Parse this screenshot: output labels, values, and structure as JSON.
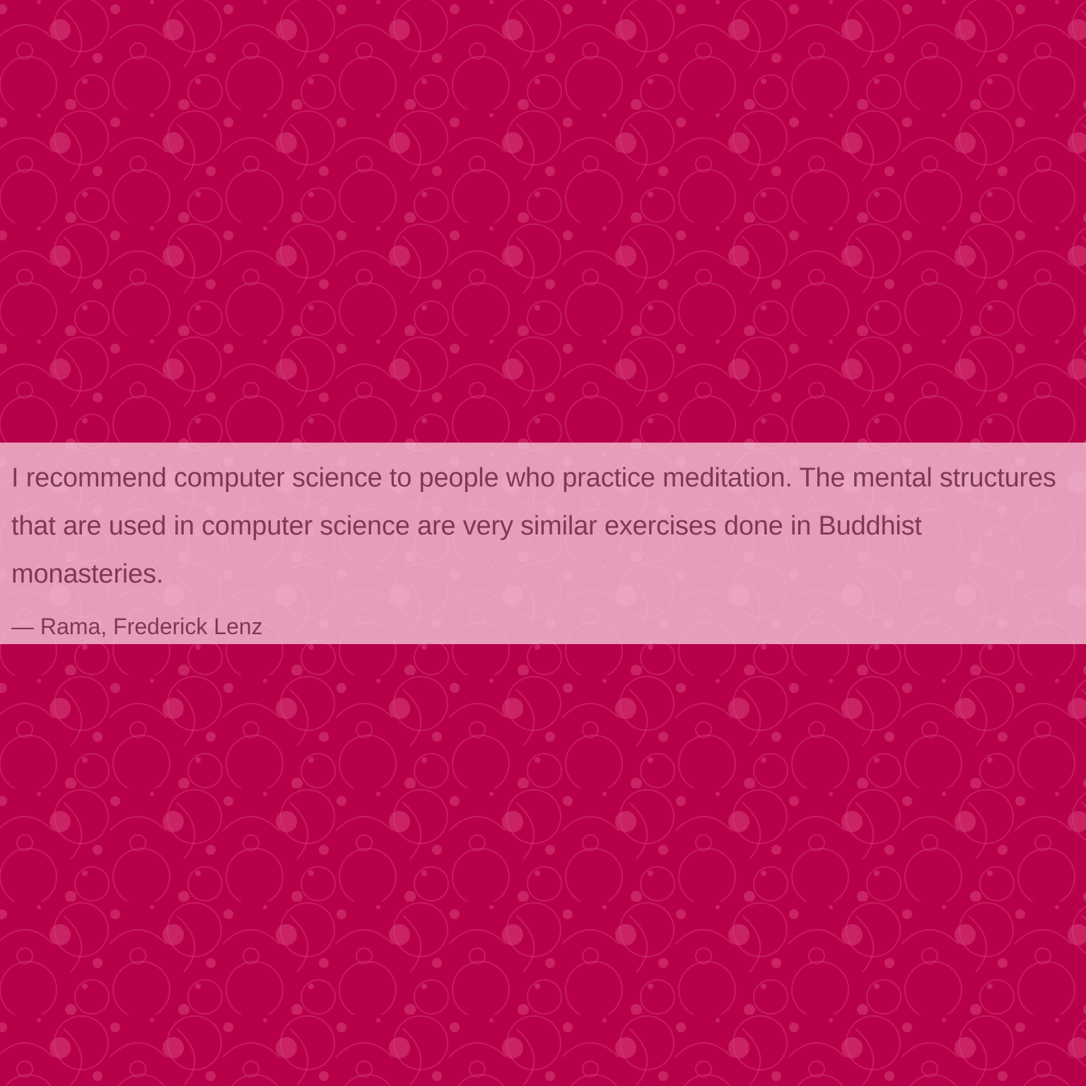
{
  "colors": {
    "background": "#b8004a",
    "band": "#f2c4d6",
    "text": "#7d3957",
    "pattern_stroke": "#d8407a"
  },
  "quote": {
    "text": "I recommend computer science to people who practice meditation. The mental structures that are used in computer science are very similar exercises done in Buddhist monasteries.",
    "attribution": "— Rama, Frederick Lenz"
  }
}
